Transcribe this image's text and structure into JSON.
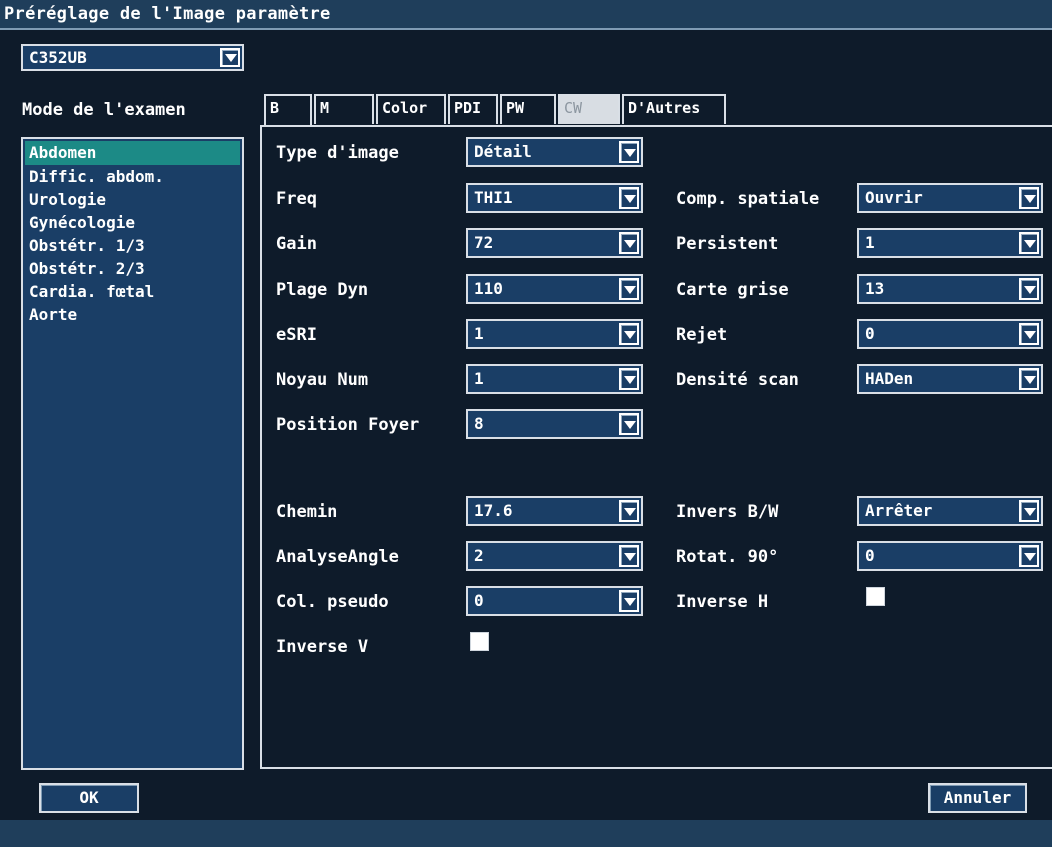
{
  "window": {
    "title": "Préréglage de l'Image paramètre"
  },
  "probe": {
    "value": "C352UB"
  },
  "exam": {
    "label": "Mode de l'examen",
    "items": [
      "Abdomen",
      "Diffic. abdom.",
      "Urologie",
      "Gynécologie",
      "Obstétr. 1/3",
      "Obstétr. 2/3",
      "Cardia. fœtal",
      "Aorte"
    ],
    "selected": "Abdomen"
  },
  "tabs": [
    "B",
    "M",
    "Color",
    "PDI",
    "PW",
    "CW",
    "D'Autres"
  ],
  "active_tab": "B",
  "disabled_tab": "CW",
  "params": {
    "type_image": {
      "label": "Type d'image",
      "value": "Détail"
    },
    "freq": {
      "label": "Freq",
      "value": "THI1"
    },
    "gain": {
      "label": "Gain",
      "value": "72"
    },
    "plage_dyn": {
      "label": "Plage Dyn",
      "value": "110"
    },
    "esri": {
      "label": "eSRI",
      "value": "1"
    },
    "noyau_num": {
      "label": "Noyau Num",
      "value": "1"
    },
    "position_foyer": {
      "label": "Position Foyer",
      "value": "8"
    },
    "comp_spatiale": {
      "label": "Comp. spatiale",
      "value": "Ouvrir"
    },
    "persistent": {
      "label": "Persistent",
      "value": "1"
    },
    "carte_grise": {
      "label": "Carte grise",
      "value": "13"
    },
    "rejet": {
      "label": "Rejet",
      "value": "0"
    },
    "densite_scan": {
      "label": "Densité scan",
      "value": "HADen"
    },
    "chemin": {
      "label": "Chemin",
      "value": "17.6"
    },
    "analyse_angle": {
      "label": "AnalyseAngle",
      "value": "2"
    },
    "col_pseudo": {
      "label": "Col. pseudo",
      "value": "0"
    },
    "inverse_v": {
      "label": "Inverse V",
      "checked": false
    },
    "invers_bw": {
      "label": "Invers B/W",
      "value": "Arrêter"
    },
    "rotat_90": {
      "label": "Rotat. 90°",
      "value": "0"
    },
    "inverse_h": {
      "label": "Inverse H",
      "checked": false
    }
  },
  "buttons": {
    "ok": "OK",
    "cancel": "Annuler"
  }
}
